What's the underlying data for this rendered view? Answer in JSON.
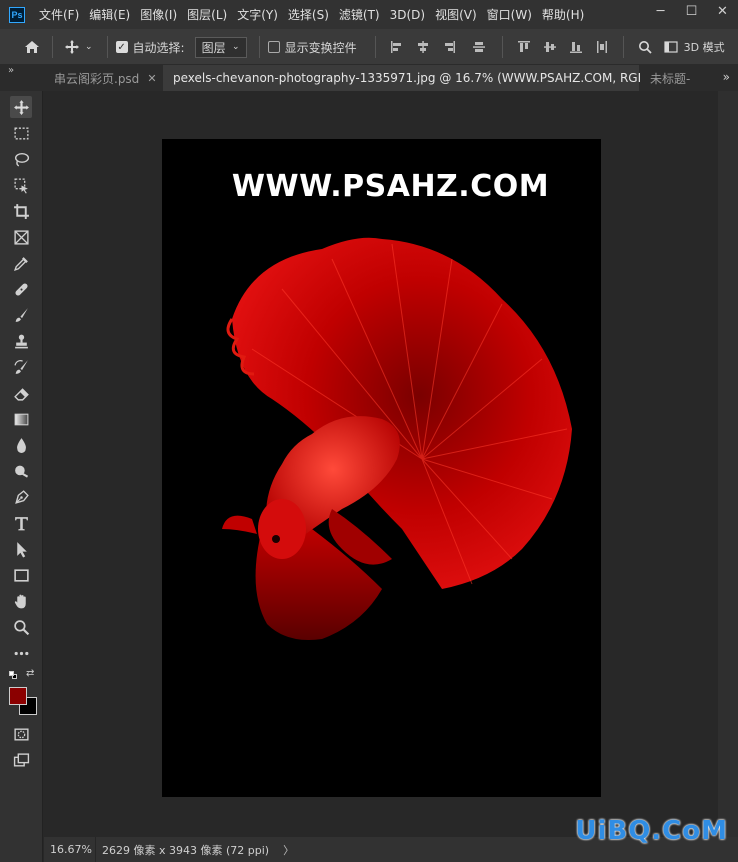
{
  "app": {
    "logo": "Ps",
    "menu": [
      "文件(F)",
      "编辑(E)",
      "图像(I)",
      "图层(L)",
      "文字(Y)",
      "选择(S)",
      "滤镜(T)",
      "3D(D)",
      "视图(V)",
      "窗口(W)",
      "帮助(H)"
    ],
    "window_controls": [
      "─",
      "☐",
      "✕"
    ]
  },
  "options": {
    "auto_select_label": "自动选择:",
    "auto_select_checked": true,
    "layer_select_value": "图层",
    "show_transform_label": "显示变换控件",
    "show_transform_checked": false,
    "mode_3d_label": "3D 模式"
  },
  "tabs": [
    {
      "label": "串云阁彩页.psd",
      "active": false
    },
    {
      "label": "pexels-chevanon-photography-1335971.jpg @ 16.7% (WWW.PSAHZ.COM, RGB/8) *",
      "active": true
    },
    {
      "label": "未标题-",
      "active": false
    }
  ],
  "tabs_overflow": "»",
  "tools": [
    "move-tool",
    "marquee-tool",
    "lasso-tool",
    "object-select-tool",
    "crop-tool",
    "frame-tool",
    "eyedropper-tool",
    "healing-brush-tool",
    "brush-tool",
    "clone-stamp-tool",
    "history-brush-tool",
    "eraser-tool",
    "gradient-tool",
    "blur-tool",
    "dodge-tool",
    "pen-tool",
    "type-tool",
    "path-select-tool",
    "rectangle-tool",
    "hand-tool",
    "zoom-tool",
    "more-tools"
  ],
  "colors": {
    "foreground": "#8b0000",
    "background": "#000000",
    "accent": "#31a8ff"
  },
  "document": {
    "watermark_text": "WWW.PSAHZ.COM"
  },
  "status": {
    "zoom": "16.67%",
    "doc_info": "2629 像素 x 3943 像素 (72 ppi)",
    "arrow": "〉"
  },
  "site_watermark": "UiBQ.CoM"
}
